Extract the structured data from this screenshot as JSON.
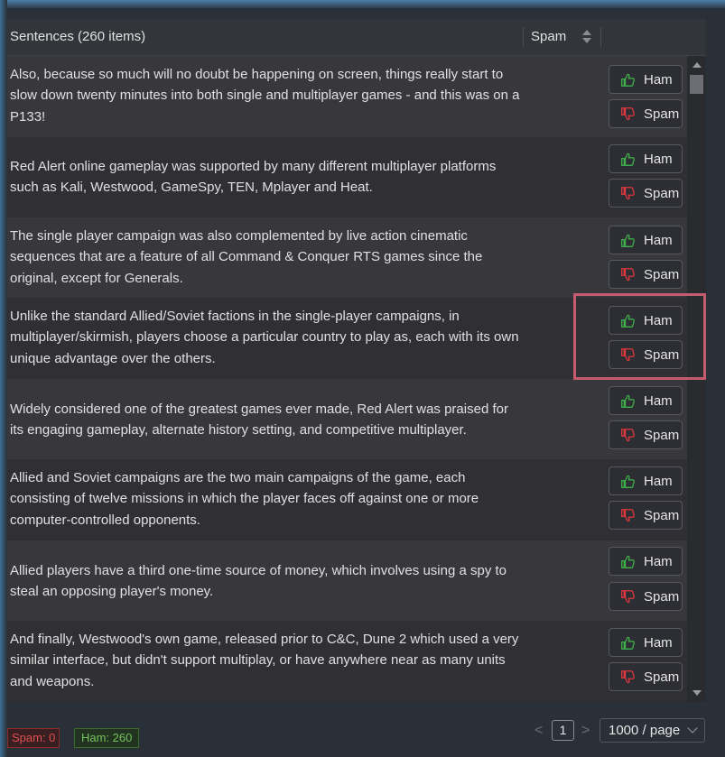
{
  "table": {
    "header": {
      "title": "Sentences (260 items)",
      "spam_column": "Spam"
    },
    "rows": [
      {
        "text": "Also, because so much will no doubt be happening on screen, things really start to slow down twenty minutes into both single and multiplayer games - and this was on a P133!",
        "ham_label": "Ham",
        "spam_label": "Spam"
      },
      {
        "text": "Red Alert online gameplay was supported by many different multiplayer platforms such as Kali, Westwood, GameSpy, TEN, Mplayer and Heat.",
        "ham_label": "Ham",
        "spam_label": "Spam"
      },
      {
        "text": "The single player campaign was also complemented by live action cinematic sequences that are a feature of all Command & Conquer RTS games since the original, except for Generals.",
        "ham_label": "Ham",
        "spam_label": "Spam"
      },
      {
        "text": "Unlike the standard Allied/Soviet factions in the single-player campaigns, in multiplayer/skirmish, players choose a particular country to play as, each with its own unique advantage over the others.",
        "ham_label": "Ham",
        "spam_label": "Spam"
      },
      {
        "text": "Widely considered one of the greatest games ever made, Red Alert was praised for its engaging gameplay, alternate history setting, and competitive multiplayer.",
        "ham_label": "Ham",
        "spam_label": "Spam"
      },
      {
        "text": "Allied and Soviet campaigns are the two main campaigns of the game, each consisting of twelve missions in which the player faces off against one or more computer-controlled opponents.",
        "ham_label": "Ham",
        "spam_label": "Spam"
      },
      {
        "text": "Allied players have a third one-time source of money, which involves using a spy to steal an opposing player's money.",
        "ham_label": "Ham",
        "spam_label": "Spam"
      },
      {
        "text": "And finally, Westwood's own game, released prior to C&C, Dune 2 which used a very similar interface, but didn't support multiplay, or have anywhere near as many units and weapons.",
        "ham_label": "Ham",
        "spam_label": "Spam"
      }
    ]
  },
  "footer": {
    "spam_count": "Spam: 0",
    "ham_count": "Ham: 260",
    "page_prev": "<",
    "page_current": "1",
    "page_next": ">",
    "page_size": "1000 / page"
  },
  "colors": {
    "ham_icon": "#3fb04a",
    "spam_icon": "#e0383e",
    "highlight": "#c55b6e"
  },
  "icons": {
    "ham": "thumbs-up-icon",
    "spam": "thumbs-down-icon",
    "sort": "sort-icon",
    "dropdown": "chevron-down-icon"
  }
}
